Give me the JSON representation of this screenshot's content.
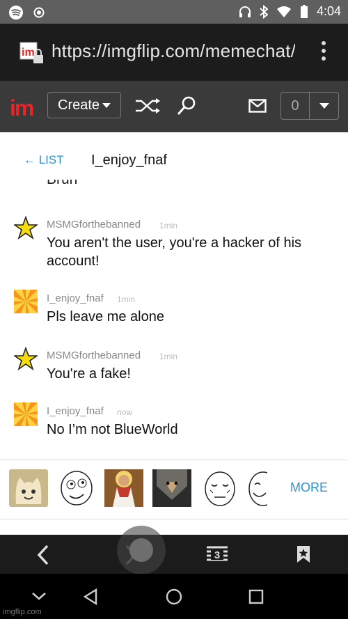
{
  "status_bar": {
    "time": "4:04"
  },
  "browser": {
    "url": "https://imgflip.com/memechat/"
  },
  "site_header": {
    "logo": "im",
    "create_label": "Create",
    "notification_count": "0"
  },
  "chat": {
    "back_label": "← LIST",
    "partner_name": "I_enjoy_fnaf",
    "cut_message": "Bruh",
    "messages": [
      {
        "user": "MSMGforthebanned",
        "time": "1min",
        "text": "You aren't the user, you're a hacker of his account!"
      },
      {
        "user": "I_enjoy_fnaf",
        "time": "1min",
        "text": "Pls leave me alone"
      },
      {
        "user": "MSMGforthebanned",
        "time": "1min",
        "text": "You're a fake!"
      },
      {
        "user": "I_enjoy_fnaf",
        "time": "now",
        "text": "No I’m not BlueWorld"
      }
    ]
  },
  "meme_bar": {
    "more_label": "MORE"
  },
  "browser_nav": {
    "tab_count": "3"
  },
  "watermark": "imgflip.com",
  "colors": {
    "accent": "#2a8fd6",
    "logo_red": "#e22222",
    "header_bg": "#3a3a3a",
    "star": "#f5dc0f"
  }
}
